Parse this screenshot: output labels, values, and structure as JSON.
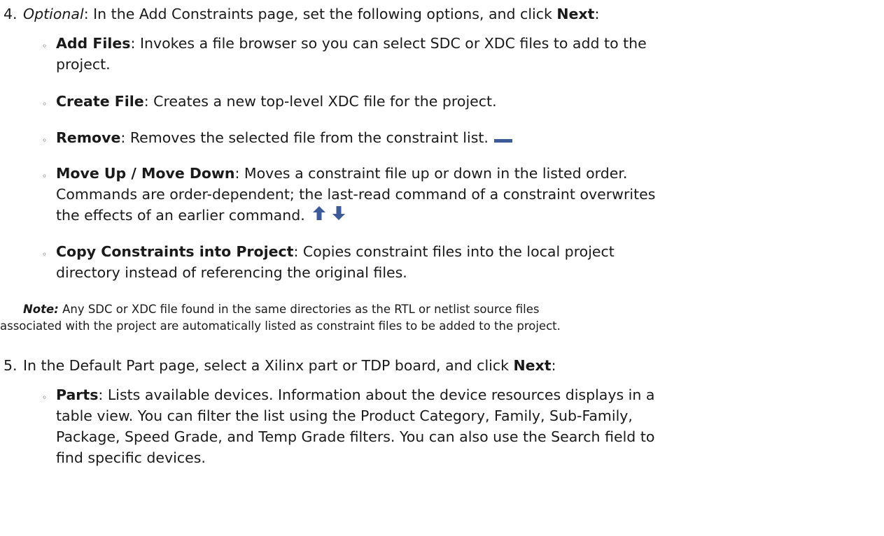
{
  "step4": {
    "number": "4.",
    "optional": "Optional",
    "text_a": ": In the Add Constraints page, set the following options, and click ",
    "next": "Next",
    "text_b": ":"
  },
  "bullets4": [
    {
      "title": "Add Files",
      "lines": [
        ": Invokes a file browser so you can select SDC or XDC files to add to the",
        "project."
      ]
    },
    {
      "title": "Create File",
      "lines": [
        ": Creates a new top-level XDC file for the project."
      ]
    },
    {
      "title": "Remove",
      "lines": [
        ": Removes the selected file from the constraint list."
      ],
      "icon": "remove-icon"
    },
    {
      "title": "Move Up / Move Down",
      "lines": [
        ": Moves a constraint file up or down in the listed order.",
        "Commands are order-dependent; the last-read command of a constraint overwrites",
        "the effects of an earlier command."
      ],
      "icons": [
        "arrow-up-icon",
        "arrow-down-icon"
      ]
    },
    {
      "title": "Copy Constraints into Project",
      "lines": [
        ": Copies constraint files into the local project",
        "directory instead of referencing the original files."
      ]
    }
  ],
  "note": {
    "label": "Note:",
    "line1": " Any SDC or XDC file found in the same directories as the RTL or netlist source files",
    "line2": "associated with the project are automatically listed as constraint files to be added to the project."
  },
  "step5": {
    "number": "5.",
    "text_a": "In the Default Part page, select a Xilinx part or TDP board, and click ",
    "next": "Next",
    "text_b": ":"
  },
  "bullets5": [
    {
      "title": "Parts",
      "lines": [
        ": Lists available devices. Information about the device resources displays in a",
        "table view. You can filter the list using the Product Category, Family, Sub-Family,",
        "Package, Speed Grade, and Temp Grade filters. You can also use the Search field to",
        "find specific devices."
      ]
    }
  ],
  "colors": {
    "icon_blue": "#3d5a99"
  }
}
